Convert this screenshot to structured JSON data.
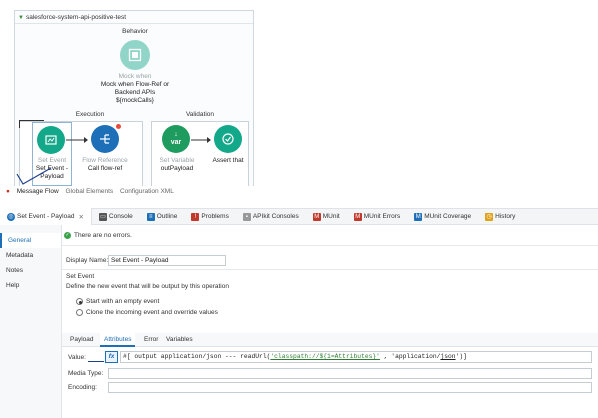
{
  "flow": {
    "name": "salesforce-system-api-positive-test",
    "behavior": {
      "title": "Behavior",
      "node_faded": "Mock when",
      "node_desc": "Mock when Flow-Ref or Backend APIs  ${mockCalls}"
    },
    "execution": {
      "title": "Execution",
      "set_event_faded": "Set Event",
      "set_event_desc": "Set Event - Payload",
      "flow_ref_faded": "Flow Reference",
      "flow_ref_desc": "Call flow-ref"
    },
    "validation": {
      "title": "Validation",
      "set_var_faded": "Set Variable",
      "set_var_desc": "outPayload",
      "set_var_icon_text": "var",
      "assert_desc": "Assert that"
    }
  },
  "canvas_tabs": [
    "Message Flow",
    "Global Elements",
    "Configuration XML"
  ],
  "view_tabs": [
    {
      "label": "Set Event - Payload",
      "icon": "set-event-icon",
      "color": "#1d6fb8"
    },
    {
      "label": "Console",
      "icon": "console-icon",
      "color": "#555"
    },
    {
      "label": "Outline",
      "icon": "outline-icon",
      "color": "#1d6fb8"
    },
    {
      "label": "Problems",
      "icon": "problems-icon",
      "color": "#c0392b"
    },
    {
      "label": "APIkit Consoles",
      "icon": "apikit-icon",
      "color": "#888"
    },
    {
      "label": "MUnit",
      "icon": "munit-icon",
      "color": "#c0392b"
    },
    {
      "label": "MUnit Errors",
      "icon": "munit-errors-icon",
      "color": "#c0392b"
    },
    {
      "label": "MUnit Coverage",
      "icon": "munit-coverage-icon",
      "color": "#1d6fb8"
    },
    {
      "label": "History",
      "icon": "history-icon",
      "color": "#e0a21a"
    }
  ],
  "side_nav": [
    "General",
    "Metadata",
    "Notes",
    "Help"
  ],
  "status": "There are no errors.",
  "display_name": {
    "label": "Display Name:",
    "value": "Set Event - Payload"
  },
  "section": {
    "title": "Set Event",
    "desc": "Define the new event that will be output by this operation",
    "option1": "Start with an empty event",
    "option2": "Clone the incoming event and override values"
  },
  "sub_tabs": [
    "Payload",
    "Attributes",
    "Error",
    "Variables"
  ],
  "fields": {
    "value_label": "Value:",
    "fx": "fx",
    "value_code_pre": "#[ output application/json --- readUrl(",
    "value_code_url": "'classpath://${1=Attributes}'",
    "value_code_mid": " , 'application/",
    "value_code_json": "json",
    "value_code_end": "')]",
    "media_type_label": "Media Type:",
    "encoding_label": "Encoding:"
  }
}
